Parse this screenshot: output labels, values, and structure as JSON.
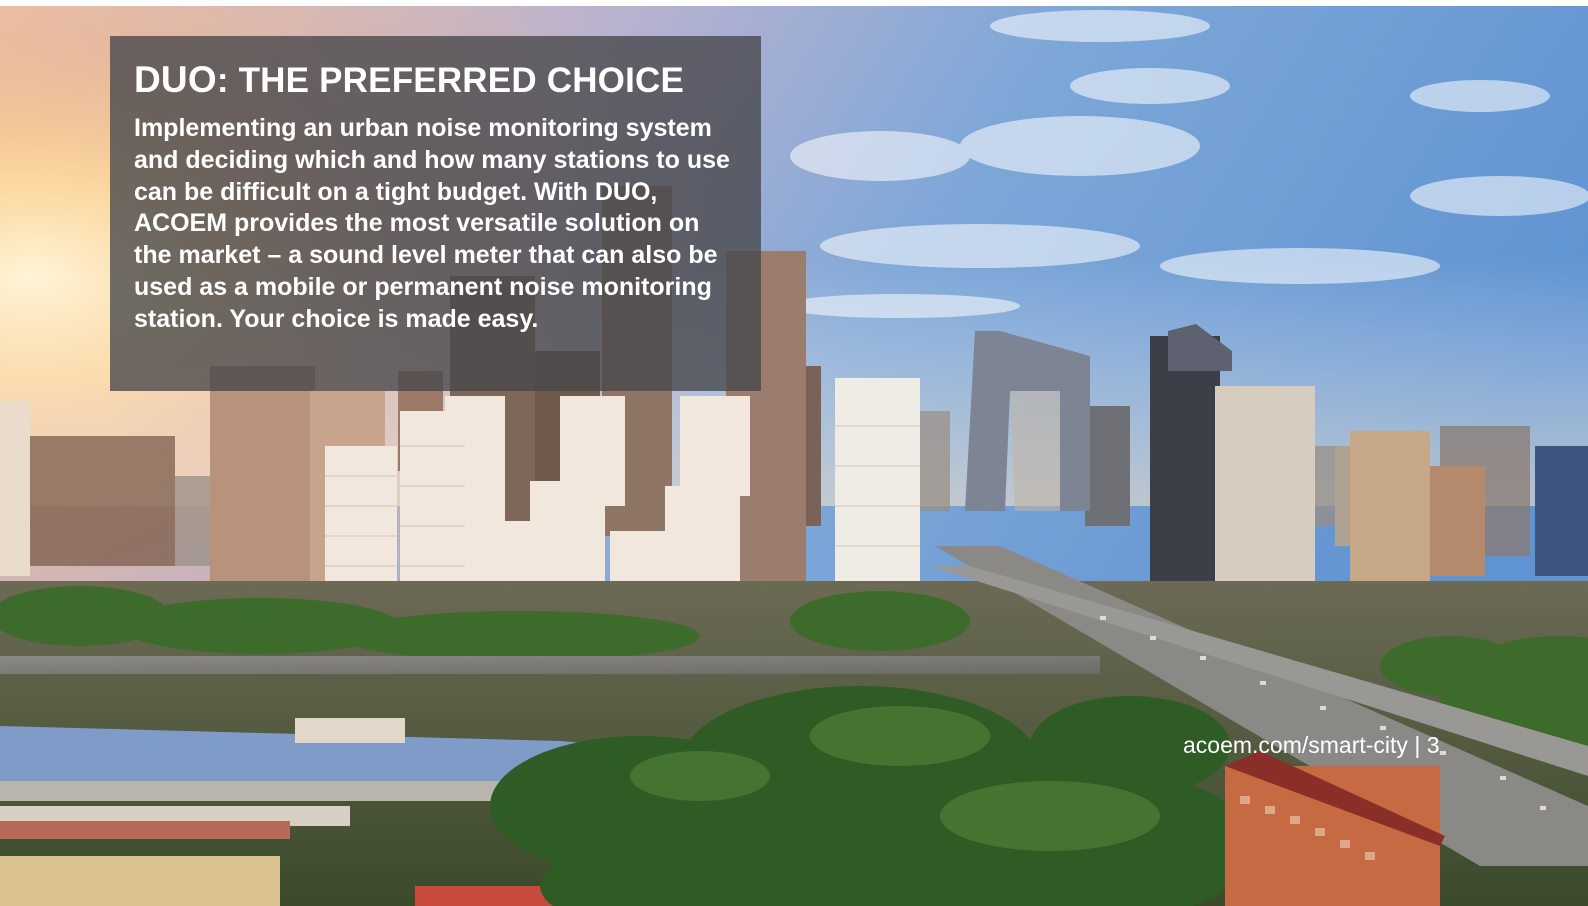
{
  "slide": {
    "title_brand": "DUO",
    "title_rest": ": THE PREFERRED CHOICE",
    "body": {
      "part1": "Implementing an urban noise monitoring system and deciding which and how many stations to use can be difficult on a tight budget. With ",
      "brand_duo": "DUO",
      "sep": ", ",
      "brand_acoem": "ACOEM",
      "part2": " provides the most versatile solution on the market – a sound level meter that can also be used as a mobile or permanent noise monitoring station. Your choice is made easy."
    },
    "footer_url": "acoem.com/smart-city",
    "footer_sep": " | ",
    "page_number": "3"
  },
  "colors": {
    "overlay": "#46464A",
    "text": "#FFFFFF",
    "sky_top": "#6F9FD6",
    "sun_glow": "#FFD79A",
    "trees": "#2F5B24"
  }
}
